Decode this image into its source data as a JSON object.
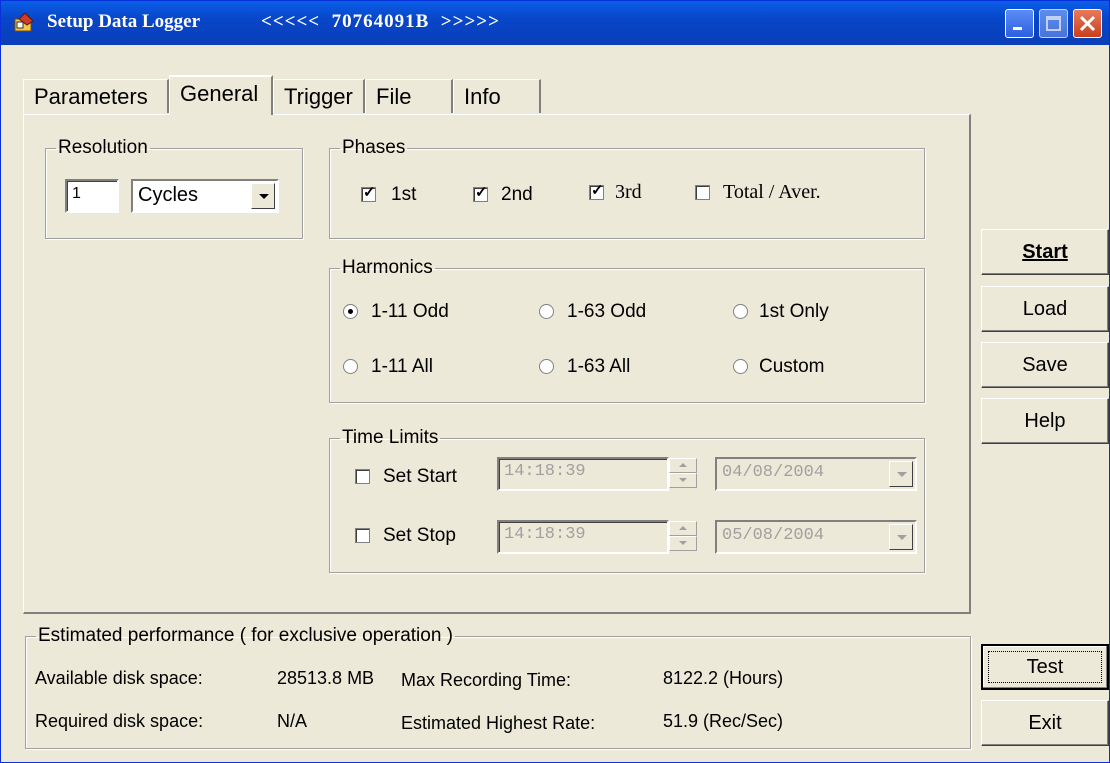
{
  "window": {
    "title": "Setup Data Logger",
    "serial": "<<<<<  70764091B  >>>>>"
  },
  "tabs": [
    {
      "label": "Parameters"
    },
    {
      "label": "General"
    },
    {
      "label": "Trigger"
    },
    {
      "label": "File"
    },
    {
      "label": "Info"
    }
  ],
  "resolution": {
    "legend": "Resolution",
    "value": "1",
    "unit": "Cycles"
  },
  "phases": {
    "legend": "Phases",
    "items": [
      {
        "label": "1st",
        "checked": true
      },
      {
        "label": "2nd",
        "checked": true
      },
      {
        "label": "3rd",
        "checked": true
      },
      {
        "label": "Total / Aver.",
        "checked": false
      }
    ]
  },
  "harmonics": {
    "legend": "Harmonics",
    "options": [
      {
        "label": "1-11 Odd",
        "selected": true
      },
      {
        "label": "1-63 Odd",
        "selected": false
      },
      {
        "label": "1st Only",
        "selected": false
      },
      {
        "label": "1-11 All",
        "selected": false
      },
      {
        "label": "1-63 All",
        "selected": false
      },
      {
        "label": "Custom",
        "selected": false
      }
    ]
  },
  "time_limits": {
    "legend": "Time Limits",
    "start": {
      "label": "Set Start",
      "time": "14:18:39",
      "date": "04/08/2004"
    },
    "stop": {
      "label": "Set Stop",
      "time": "14:18:39",
      "date": "05/08/2004"
    }
  },
  "buttons": {
    "start": "Start",
    "load": "Load",
    "save": "Save",
    "help": "Help",
    "test": "Test",
    "exit": "Exit"
  },
  "performance": {
    "legend": "Estimated performance ( for exclusive operation )",
    "available_label": "Available  disk space:",
    "available_value": "28513.8 MB",
    "required_label": "Required disk space:",
    "required_value": "N/A",
    "max_time_label": "Max Recording Time:",
    "max_time_value": "8122.2 (Hours)",
    "rate_label": "Estimated Highest Rate:",
    "rate_value": "51.9 (Rec/Sec)"
  }
}
